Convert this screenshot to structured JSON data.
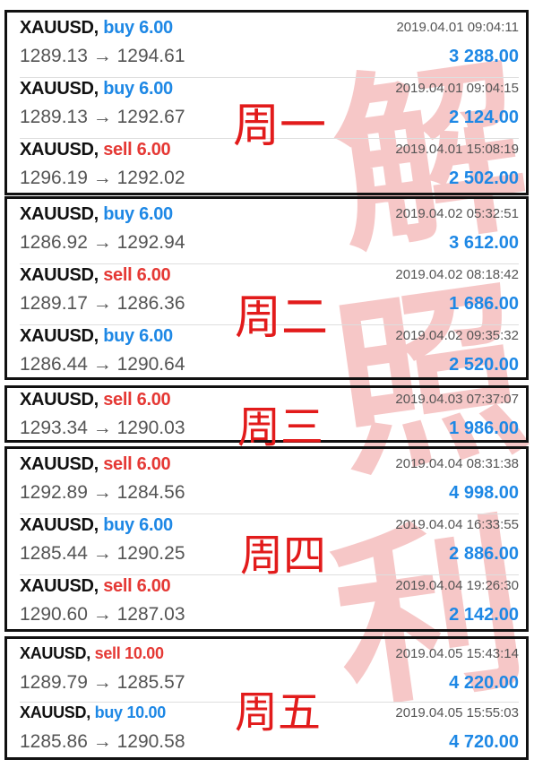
{
  "watermark_chars": [
    "解",
    "照",
    "利"
  ],
  "colors": {
    "buy": "#1e88e5",
    "sell": "#e53935",
    "profit": "#1e88e5",
    "day_label": "#e21b1b"
  },
  "groups": [
    {
      "day": "周一",
      "trades": [
        {
          "symbol": "XAUUSD,",
          "direction": "buy",
          "volume": "6.00",
          "time": "2019.04.01 09:04:11",
          "open": "1289.13",
          "close": "1294.61",
          "profit": "3 288.00"
        },
        {
          "symbol": "XAUUSD,",
          "direction": "buy",
          "volume": "6.00",
          "time": "2019.04.01 09:04:15",
          "open": "1289.13",
          "close": "1292.67",
          "profit": "2 124.00"
        },
        {
          "symbol": "XAUUSD,",
          "direction": "sell",
          "volume": "6.00",
          "time": "2019.04.01 15:08:19",
          "open": "1296.19",
          "close": "1292.02",
          "profit": "2 502.00"
        }
      ]
    },
    {
      "day": "周二",
      "trades": [
        {
          "symbol": "XAUUSD,",
          "direction": "buy",
          "volume": "6.00",
          "time": "2019.04.02 05:32:51",
          "open": "1286.92",
          "close": "1292.94",
          "profit": "3 612.00"
        },
        {
          "symbol": "XAUUSD,",
          "direction": "sell",
          "volume": "6.00",
          "time": "2019.04.02 08:18:42",
          "open": "1289.17",
          "close": "1286.36",
          "profit": "1 686.00"
        },
        {
          "symbol": "XAUUSD,",
          "direction": "buy",
          "volume": "6.00",
          "time": "2019.04.02 09:35:32",
          "open": "1286.44",
          "close": "1290.64",
          "profit": "2 520.00"
        }
      ]
    },
    {
      "day": "周三",
      "trades": [
        {
          "symbol": "XAUUSD,",
          "direction": "sell",
          "volume": "6.00",
          "time": "2019.04.03 07:37:07",
          "open": "1293.34",
          "close": "1290.03",
          "profit": "1 986.00"
        }
      ]
    },
    {
      "day": "周四",
      "trades": [
        {
          "symbol": "XAUUSD,",
          "direction": "sell",
          "volume": "6.00",
          "time": "2019.04.04 08:31:38",
          "open": "1292.89",
          "close": "1284.56",
          "profit": "4 998.00"
        },
        {
          "symbol": "XAUUSD,",
          "direction": "buy",
          "volume": "6.00",
          "time": "2019.04.04 16:33:55",
          "open": "1285.44",
          "close": "1290.25",
          "profit": "2 886.00"
        },
        {
          "symbol": "XAUUSD,",
          "direction": "sell",
          "volume": "6.00",
          "time": "2019.04.04 19:26:30",
          "open": "1290.60",
          "close": "1287.03",
          "profit": "2 142.00"
        }
      ]
    },
    {
      "day": "周五",
      "trades": [
        {
          "symbol": "XAUUSD,",
          "direction": "sell",
          "volume": "10.00",
          "time": "2019.04.05 15:43:14",
          "open": "1289.79",
          "close": "1285.57",
          "profit": "4 220.00"
        },
        {
          "symbol": "XAUUSD,",
          "direction": "buy",
          "volume": "10.00",
          "time": "2019.04.05 15:55:03",
          "open": "1285.86",
          "close": "1290.58",
          "profit": "4 720.00"
        }
      ]
    }
  ]
}
